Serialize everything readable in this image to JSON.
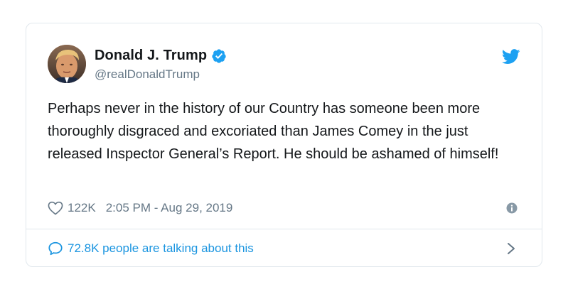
{
  "author": {
    "name": "Donald J. Trump",
    "handle": "@realDonaldTrump"
  },
  "tweet": {
    "text": "Perhaps never in the history of our Country has someone been more thoroughly disgraced and excoriated than James Comey in the just released Inspector General’s Report. He should be ashamed of himself!"
  },
  "meta": {
    "likes": "122K",
    "timestamp": "2:05 PM - Aug 29, 2019"
  },
  "footer": {
    "conversation_label": "72.8K people are talking about this"
  },
  "icons": {
    "verified": "verified-badge-icon",
    "brand": "twitter-bird-icon",
    "like": "heart-icon",
    "info": "info-icon",
    "reply": "speech-bubble-icon",
    "chevron": "chevron-right-icon"
  },
  "colors": {
    "accent": "#1da1f2",
    "link": "#1b95e0",
    "text": "#14171a",
    "muted": "#657786",
    "border": "#e1e8ed"
  }
}
